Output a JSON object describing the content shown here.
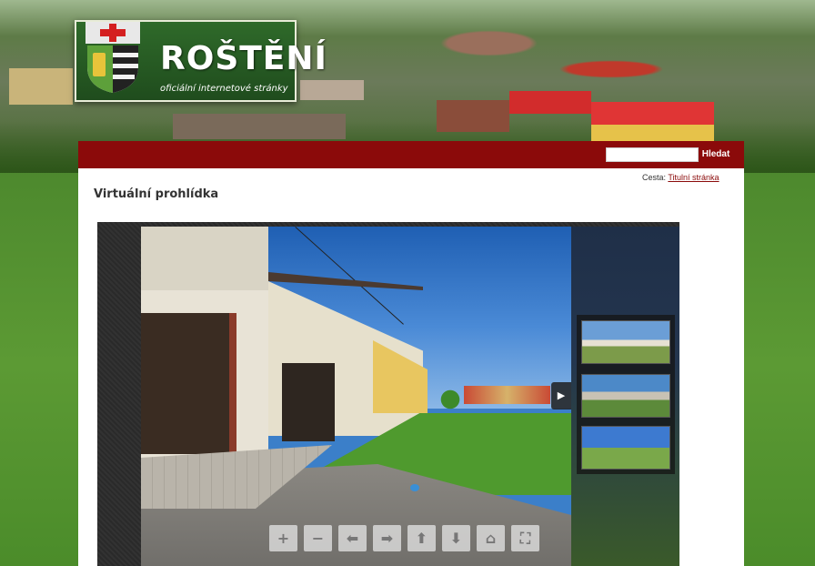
{
  "header": {
    "site_name": "ROŠTĚNÍ",
    "site_subtitle": "oficiální internetové stránky"
  },
  "search": {
    "value": "",
    "placeholder": "",
    "button_label": "Hledat"
  },
  "breadcrumb": {
    "prefix": "Cesta:",
    "link": "Titulní stránka"
  },
  "page": {
    "title": "Virtuální prohlídka"
  },
  "viewer": {
    "play_icon": "▶",
    "toolbar": [
      {
        "name": "zoom-in-icon",
        "glyph": "+"
      },
      {
        "name": "zoom-out-icon",
        "glyph": "−"
      },
      {
        "name": "arrow-left-icon",
        "glyph": "⬅"
      },
      {
        "name": "arrow-right-icon",
        "glyph": "➡"
      },
      {
        "name": "arrow-up-icon",
        "glyph": "⬆"
      },
      {
        "name": "arrow-down-icon",
        "glyph": "⬇"
      },
      {
        "name": "home-icon",
        "glyph": "⌂"
      },
      {
        "name": "fullscreen-icon",
        "glyph": "⛶"
      }
    ]
  },
  "colors": {
    "brand_red": "#8b0a0a",
    "bg_green": "#4e8a2e"
  }
}
